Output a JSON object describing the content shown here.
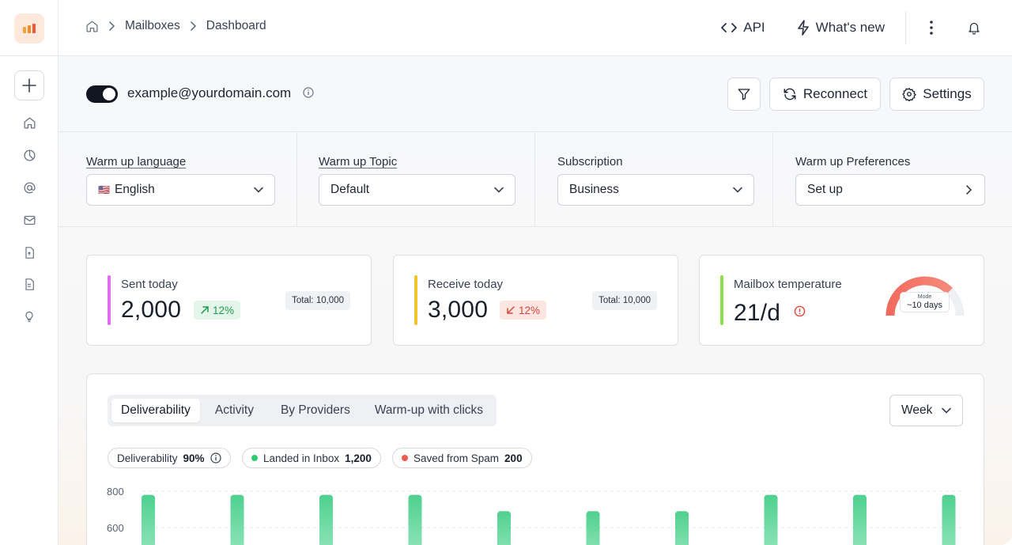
{
  "breadcrumb": {
    "items": [
      "Mailboxes",
      "Dashboard"
    ]
  },
  "header": {
    "api_label": "API",
    "whats_new_label": "What's new"
  },
  "account": {
    "email": "example@yourdomain.com",
    "enabled": true,
    "reconnect_label": "Reconnect",
    "settings_label": "Settings"
  },
  "filters": {
    "language": {
      "label": "Warm up language",
      "value": "English",
      "flag": "🇺🇸"
    },
    "topic": {
      "label": "Warm up Topic",
      "value": "Default"
    },
    "subscription": {
      "label": "Subscription",
      "value": "Business"
    },
    "preferences": {
      "label": "Warm up Preferences",
      "value": "Set up"
    }
  },
  "stats": {
    "sent": {
      "label": "Sent today",
      "value": "2,000",
      "change": "12%",
      "total": "Total: 10,000",
      "color": "#e06bf0"
    },
    "receive": {
      "label": "Receive today",
      "value": "3,000",
      "change": "12%",
      "total": "Total: 10,000",
      "color": "#f2c428"
    },
    "temperature": {
      "label": "Mailbox temperature",
      "value": "21/d",
      "gauge_caption": "Mode",
      "gauge_value": "~10 days",
      "gauge_level": 0.75,
      "color": "#8be04b"
    }
  },
  "tabs": [
    "Deliverability",
    "Activity",
    "By Providers",
    "Warm-up with clicks"
  ],
  "period": "Week",
  "metrics": {
    "deliverability": {
      "label": "Deliverability",
      "value": "90%"
    },
    "inbox": {
      "label": "Landed in Inbox",
      "value": "1,200",
      "color": "#2ecc71"
    },
    "spam": {
      "label": "Saved from Spam",
      "value": "200",
      "color": "#ef5b50"
    }
  },
  "chart_data": {
    "type": "bar",
    "y_ticks": [
      "800",
      "600"
    ],
    "values": [
      780,
      780,
      780,
      780,
      690,
      690,
      690,
      780,
      780,
      780
    ],
    "color": "#5bd89a"
  }
}
